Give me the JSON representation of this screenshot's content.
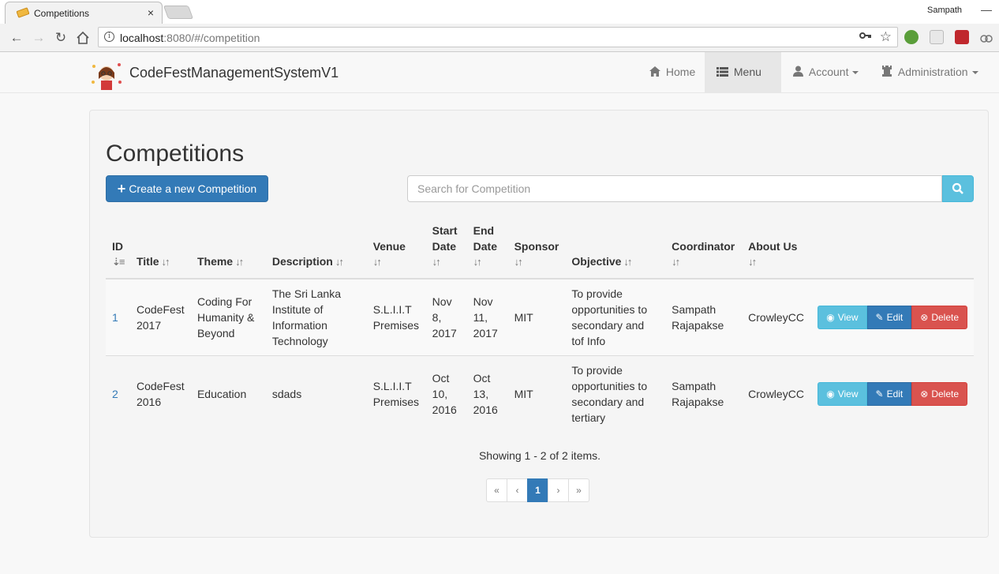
{
  "browser": {
    "tab_title": "Competitions",
    "tab_close": "×",
    "profile_name": "Sampath",
    "minimize": "—",
    "url_host": "localhost",
    "url_path": ":8080/#/competition"
  },
  "navbar": {
    "brand": "CodeFestManagementSystemV1",
    "home": "Home",
    "menu": "Menu",
    "account": "Account",
    "administration": "Administration"
  },
  "page": {
    "title": "Competitions",
    "create_label": "Create a new Competition",
    "search_placeholder": "Search for Competition"
  },
  "table": {
    "headers": {
      "id": "ID",
      "title": "Title",
      "theme": "Theme",
      "description": "Description",
      "venue": "Venue",
      "start_date_1": "Start",
      "start_date_2": "Date",
      "end_date_1": "End",
      "end_date_2": "Date",
      "sponsor": "Sponsor",
      "objective": "Objective",
      "coordinator": "Coordinator",
      "about_us": "About Us"
    },
    "rows": [
      {
        "id": "1",
        "title": "CodeFest 2017",
        "theme": "Coding For Humanity & Beyond",
        "description": "The Sri Lanka Institute of Information Technology",
        "venue": "S.L.I.I.T Premises",
        "start_date": "Nov 8, 2017",
        "end_date": "Nov 11, 2017",
        "sponsor": "MIT",
        "objective": "To provide opportunities to secondary and tof Info",
        "coordinator": "Sampath Rajapakse",
        "about_us": "CrowleyCC"
      },
      {
        "id": "2",
        "title": "CodeFest 2016",
        "theme": "Education",
        "description": "sdads",
        "venue": "S.L.I.I.T Premises",
        "start_date": "Oct 10, 2016",
        "end_date": "Oct 13, 2016",
        "sponsor": "MIT",
        "objective": "To provide opportunities to secondary and tertiary",
        "coordinator": "Sampath Rajapakse",
        "about_us": "CrowleyCC"
      }
    ],
    "actions": {
      "view": "View",
      "edit": "Edit",
      "delete": "Delete"
    }
  },
  "footer": {
    "showing": "Showing 1 - 2 of 2 items.",
    "pages": [
      "«",
      "‹",
      "1",
      "›",
      "»"
    ]
  },
  "colors": {
    "primary": "#337ab7",
    "info": "#5bc0de",
    "danger": "#d9534f"
  },
  "icons": {
    "home": "home-icon",
    "menu": "list-icon",
    "account": "user-icon",
    "administration": "tower-icon",
    "search": "search-icon",
    "view": "eye-icon",
    "edit": "pencil-icon",
    "delete": "remove-circle-icon"
  }
}
